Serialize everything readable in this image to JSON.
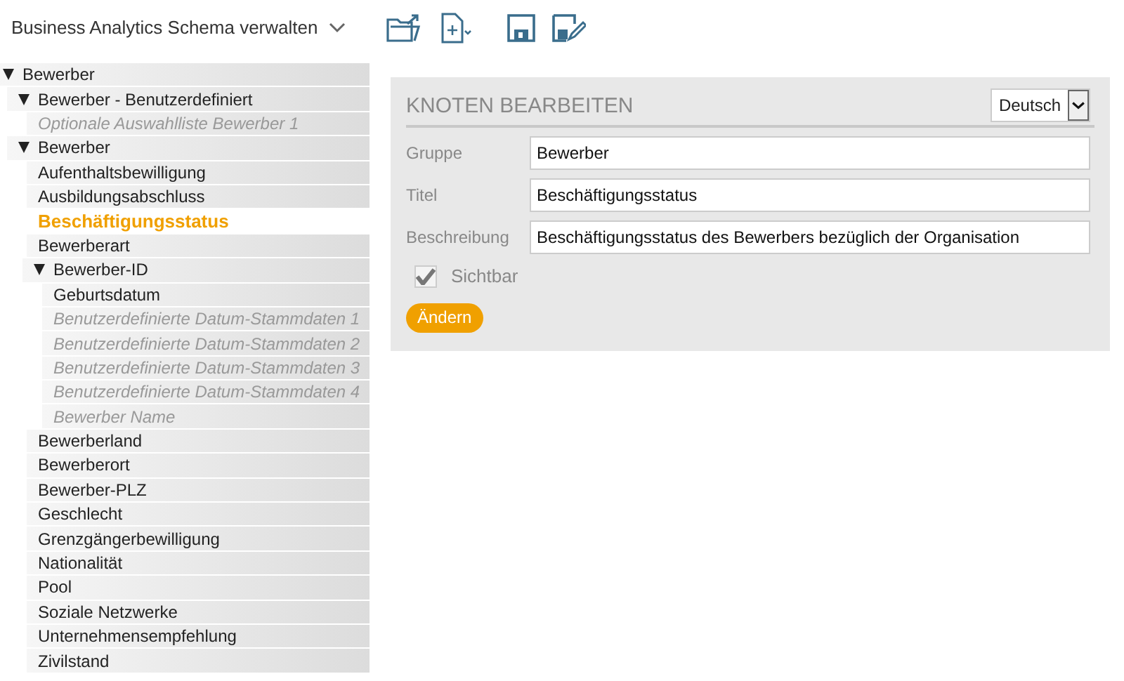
{
  "header": {
    "title": "Business Analytics Schema verwalten"
  },
  "tree": [
    {
      "label": "Bewerber",
      "expanded": true,
      "visible": true,
      "selected": false,
      "children": [
        {
          "label": "Bewerber - Benutzerdefiniert",
          "expanded": true,
          "visible": true,
          "selected": false,
          "children": [
            {
              "label": "Optionale Auswahlliste Bewerber 1",
              "visible": false,
              "selected": false
            }
          ]
        },
        {
          "label": "Bewerber",
          "expanded": true,
          "visible": true,
          "selected": false,
          "children": [
            {
              "label": "Aufenthaltsbewilligung",
              "visible": true,
              "selected": false
            },
            {
              "label": "Ausbildungsabschluss",
              "visible": true,
              "selected": false
            },
            {
              "label": "Beschäftigungsstatus",
              "visible": true,
              "selected": true
            },
            {
              "label": "Bewerberart",
              "visible": true,
              "selected": false
            },
            {
              "label": "Bewerber-ID",
              "expanded": true,
              "visible": true,
              "selected": false,
              "children": [
                {
                  "label": "Geburtsdatum",
                  "visible": true,
                  "selected": false
                },
                {
                  "label": "Benutzerdefinierte Datum-Stammdaten 1",
                  "visible": false,
                  "selected": false
                },
                {
                  "label": "Benutzerdefinierte Datum-Stammdaten 2",
                  "visible": false,
                  "selected": false
                },
                {
                  "label": "Benutzerdefinierte Datum-Stammdaten 3",
                  "visible": false,
                  "selected": false
                },
                {
                  "label": "Benutzerdefinierte Datum-Stammdaten 4",
                  "visible": false,
                  "selected": false
                },
                {
                  "label": "Bewerber Name",
                  "visible": false,
                  "selected": false
                }
              ]
            },
            {
              "label": "Bewerberland",
              "visible": true,
              "selected": false
            },
            {
              "label": "Bewerberort",
              "visible": true,
              "selected": false
            },
            {
              "label": "Bewerber-PLZ",
              "visible": true,
              "selected": false
            },
            {
              "label": "Geschlecht",
              "visible": true,
              "selected": false
            },
            {
              "label": "Grenzgängerbewilligung",
              "visible": true,
              "selected": false
            },
            {
              "label": "Nationalität",
              "visible": true,
              "selected": false
            },
            {
              "label": "Pool",
              "visible": true,
              "selected": false
            },
            {
              "label": "Soziale Netzwerke",
              "visible": true,
              "selected": false
            },
            {
              "label": "Unternehmensempfehlung",
              "visible": true,
              "selected": false
            },
            {
              "label": "Zivilstand",
              "visible": true,
              "selected": false
            }
          ]
        }
      ]
    }
  ],
  "editor": {
    "title": "KNOTEN BEARBEITEN",
    "language": "Deutsch",
    "fields": [
      {
        "label": "Gruppe",
        "value": "Bewerber"
      },
      {
        "label": "Titel",
        "value": "Beschäftigungsstatus"
      },
      {
        "label": "Beschreibung",
        "value": "Beschäftigungsstatus des Bewerbers bezüglich der Organisation"
      }
    ],
    "visible_checkbox": {
      "label": "Sichtbar",
      "checked": true
    },
    "button": "Ändern"
  }
}
